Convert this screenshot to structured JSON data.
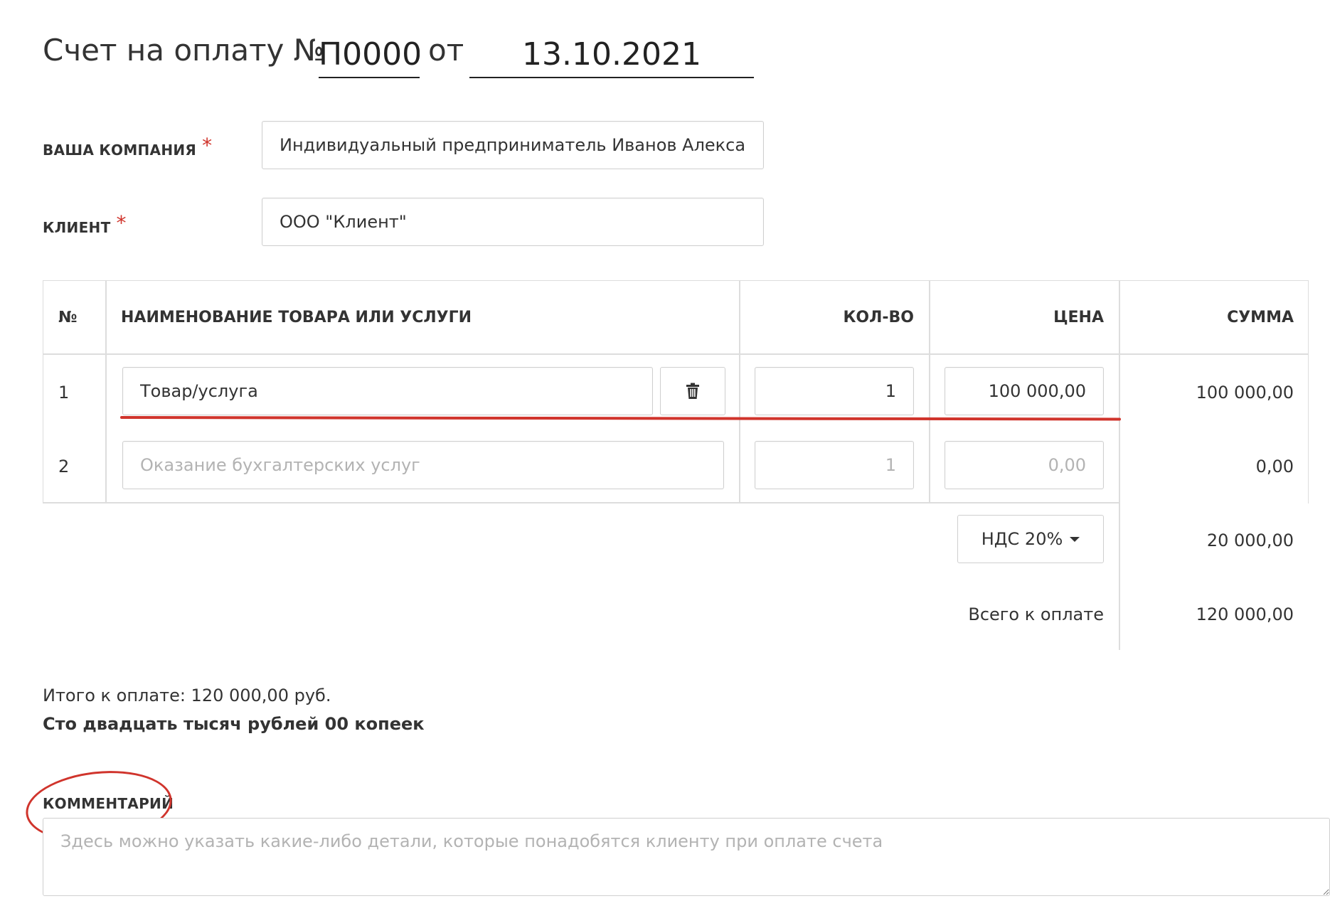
{
  "header": {
    "title_prefix": "Счет на оплату №",
    "invoice_number": "П0000",
    "from_label": "от",
    "invoice_date": "13.10.2021"
  },
  "form": {
    "company_label": "ВАША КОМПАНИЯ",
    "company_value": "Индивидуальный предприниматель Иванов Александ",
    "client_label": "КЛИЕНТ",
    "client_value": "ООО \"Клиент\"",
    "required_mark": "*"
  },
  "table": {
    "headers": {
      "num": "№",
      "name": "НАИМЕНОВАНИЕ ТОВАРА ИЛИ УСЛУГИ",
      "qty": "КОЛ-ВО",
      "price": "ЦЕНА",
      "sum": "СУММА"
    },
    "rows": [
      {
        "num": "1",
        "name": "Товар/услуга",
        "name_placeholder": "",
        "qty": "1",
        "qty_placeholder": "",
        "price": "100 000,00",
        "price_placeholder": "",
        "sum": "100 000,00"
      },
      {
        "num": "2",
        "name": "",
        "name_placeholder": "Оказание бухгалтерских услуг",
        "qty": "",
        "qty_placeholder": "1",
        "price": "",
        "price_placeholder": "0,00",
        "sum": "0,00"
      }
    ],
    "vat_label": "НДС 20%",
    "vat_sum": "20 000,00",
    "total_label": "Всего к оплате",
    "total_sum": "120 000,00"
  },
  "summary": {
    "total_line": "Итого к оплате: 120 000,00 руб.",
    "total_words": "Сто двадцать тысяч рублей 00 копеек"
  },
  "comment": {
    "label": "КОММЕНТАРИЙ",
    "placeholder": "Здесь можно указать какие-либо детали, которые понадобятся клиенту при оплате счета"
  },
  "colors": {
    "accent_red": "#d0342c",
    "border": "#cfcfcf",
    "text": "#333333",
    "placeholder": "#b3b3b3"
  },
  "icons": {
    "delete": "trash-icon",
    "dropdown": "caret-down-icon"
  }
}
